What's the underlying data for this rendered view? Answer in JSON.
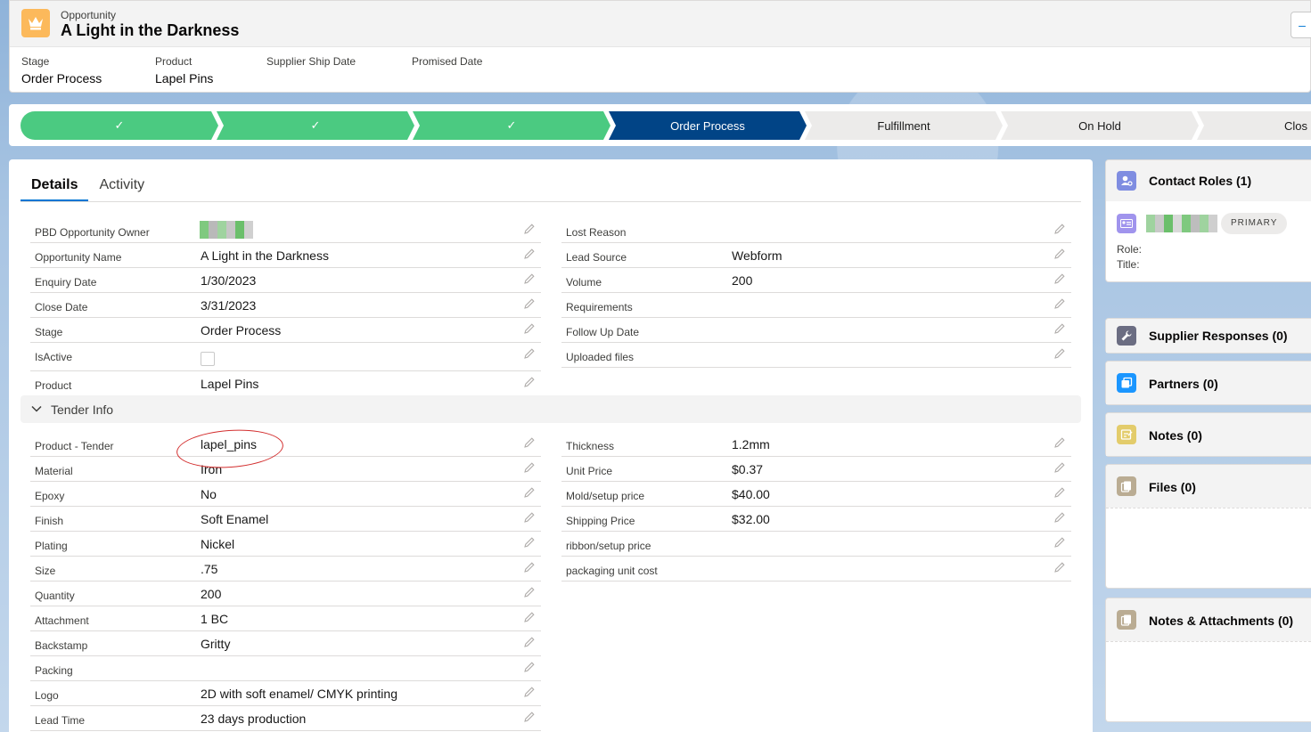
{
  "header": {
    "object_label": "Opportunity",
    "title": "A Light in the Darkness",
    "button_label": "–",
    "highlights": [
      {
        "label": "Stage",
        "value": "Order Process"
      },
      {
        "label": "Product",
        "value": "Lapel Pins"
      },
      {
        "label": "Supplier Ship Date",
        "value": ""
      },
      {
        "label": "Promised Date",
        "value": ""
      }
    ]
  },
  "path": {
    "stages": [
      {
        "label": "",
        "state": "done"
      },
      {
        "label": "",
        "state": "done"
      },
      {
        "label": "",
        "state": "done"
      },
      {
        "label": "Order Process",
        "state": "current"
      },
      {
        "label": "Fulfillment",
        "state": "todo"
      },
      {
        "label": "On Hold",
        "state": "todo"
      },
      {
        "label": "Clos",
        "state": "todo"
      }
    ],
    "check_glyph": "✓"
  },
  "tabs": [
    {
      "label": "Details",
      "active": true
    },
    {
      "label": "Activity",
      "active": false
    }
  ],
  "details_left": [
    {
      "label": "PBD Opportunity Owner",
      "value": ""
    },
    {
      "label": "Opportunity Name",
      "value": "A Light in the Darkness"
    },
    {
      "label": "Enquiry Date",
      "value": "1/30/2023"
    },
    {
      "label": "Close Date",
      "value": "3/31/2023"
    },
    {
      "label": "Stage",
      "value": "Order Process"
    },
    {
      "label": "IsActive",
      "value": ""
    },
    {
      "label": "Product",
      "value": "Lapel Pins"
    }
  ],
  "details_right": [
    {
      "label": "Lost Reason",
      "value": ""
    },
    {
      "label": "Lead Source",
      "value": "Webform"
    },
    {
      "label": "Volume",
      "value": "200"
    },
    {
      "label": "Requirements",
      "value": ""
    },
    {
      "label": "Follow Up Date",
      "value": ""
    },
    {
      "label": "Uploaded files",
      "value": ""
    }
  ],
  "tender_section": {
    "title": "Tender Info"
  },
  "tender_left": [
    {
      "label": "Product - Tender",
      "value": "lapel_pins"
    },
    {
      "label": "Material",
      "value": "Iron"
    },
    {
      "label": "Epoxy",
      "value": "No"
    },
    {
      "label": "Finish",
      "value": "Soft Enamel"
    },
    {
      "label": "Plating",
      "value": "Nickel"
    },
    {
      "label": "Size",
      "value": ".75"
    },
    {
      "label": "Quantity",
      "value": "200"
    },
    {
      "label": "Attachment",
      "value": "1 BC"
    },
    {
      "label": "Backstamp",
      "value": "Gritty"
    },
    {
      "label": "Packing",
      "value": ""
    },
    {
      "label": "Logo",
      "value": "2D with soft enamel/ CMYK printing"
    },
    {
      "label": "Lead Time",
      "value": "23 days production"
    }
  ],
  "tender_right": [
    {
      "label": "Thickness",
      "value": "1.2mm"
    },
    {
      "label": "Unit Price",
      "value": "$0.37"
    },
    {
      "label": "Mold/setup price",
      "value": "$40.00"
    },
    {
      "label": "Shipping Price",
      "value": "$32.00"
    },
    {
      "label": "ribbon/setup price",
      "value": ""
    },
    {
      "label": "packaging unit cost",
      "value": ""
    }
  ],
  "sidebar": {
    "contact_roles": {
      "title": "Contact Roles (1)",
      "badge": "PRIMARY",
      "role_label": "Role:",
      "title_label": "Title:"
    },
    "supplier_responses": {
      "title": "Supplier Responses (0)"
    },
    "partners": {
      "title": "Partners (0)"
    },
    "notes": {
      "title": "Notes (0)"
    },
    "files": {
      "title": "Files (0)"
    },
    "notes_attachments": {
      "title": "Notes & Attachments (0)"
    }
  },
  "colors": {
    "path_done": "#4bca81",
    "path_current": "#014486",
    "path_todo": "#ecebea",
    "brand": "#0176d3",
    "opportunity_icon": "#fcb95b",
    "annotation": "#d32f2f"
  }
}
